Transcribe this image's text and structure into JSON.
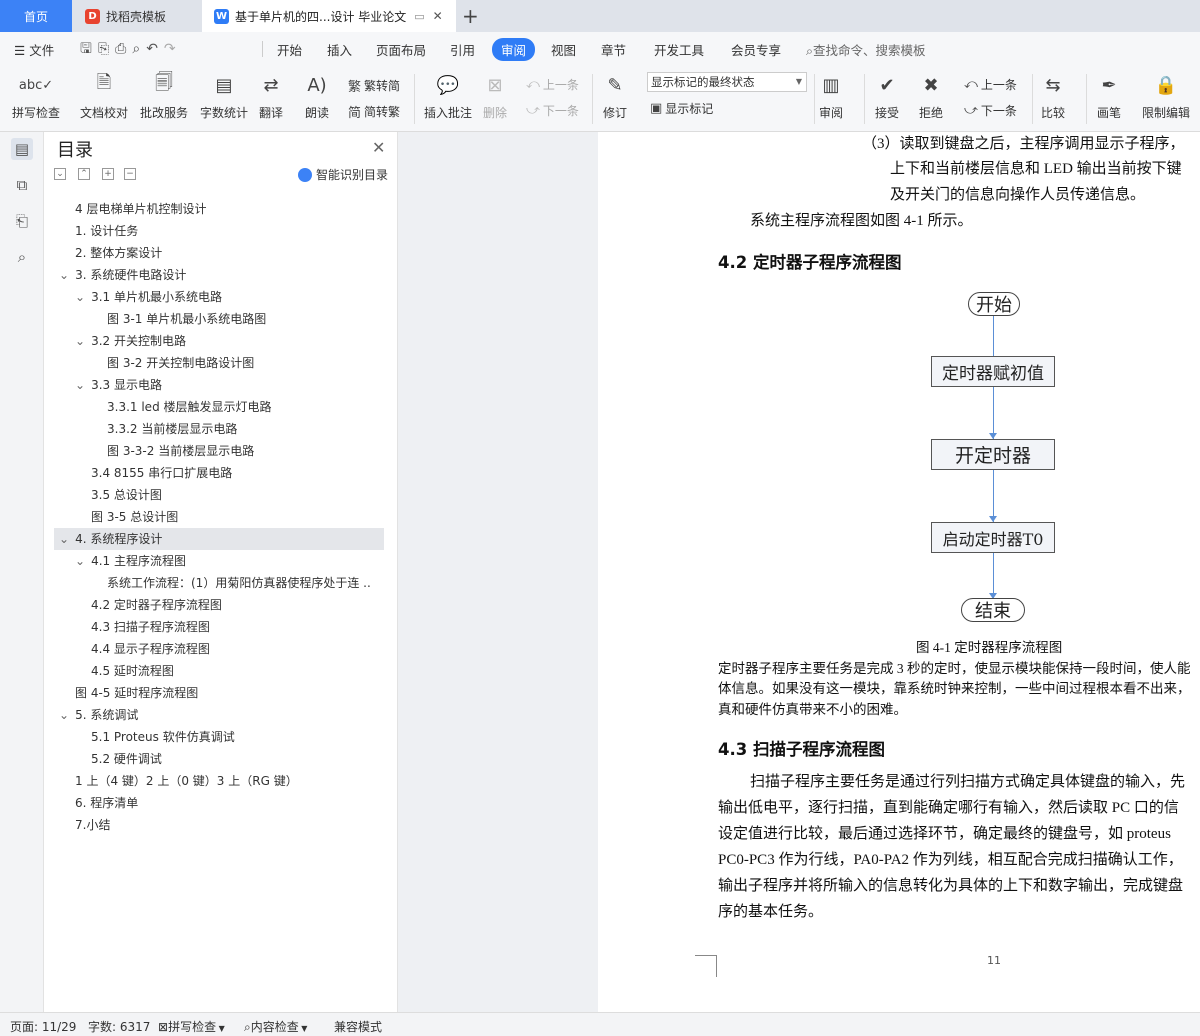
{
  "tabs": {
    "home": "首页",
    "template": "找稻壳模板",
    "document": "基于单片机的四...设计 毕业论文"
  },
  "menu": {
    "file": "文件",
    "items": [
      "开始",
      "插入",
      "页面布局",
      "引用",
      "审阅",
      "视图",
      "章节",
      "开发工具",
      "会员专享"
    ],
    "search": "查找命令、搜索模板"
  },
  "ribbon": {
    "spell": "拼写检查",
    "proof": "文档校对",
    "batch": "批改服务",
    "wordcount": "字数统计",
    "translate": "翻译",
    "read": "朗读",
    "to_trad": "繁转简",
    "to_simp": "简转繁",
    "insert_comment": "插入批注",
    "delete": "删除",
    "prev": "上一条",
    "next": "下一条",
    "track": "修订",
    "markup_state": "显示标记的最终状态",
    "show_markup": "显示标记",
    "review": "审阅",
    "accept": "接受",
    "reject": "拒绝",
    "prev2": "上一条",
    "next2": "下一条",
    "compare": "比较",
    "pen": "画笔",
    "restrict": "限制编辑"
  },
  "nav": {
    "title": "目录",
    "smart": "智能识别目录",
    "items": [
      "4 层电梯单片机控制设计",
      "1. 设计任务",
      "2. 整体方案设计",
      "3. 系统硬件电路设计",
      "3.1  单片机最小系统电路",
      "图 3-1  单片机最小系统电路图",
      "3.2  开关控制电路",
      "图 3-2  开关控制电路设计图",
      "3.3  显示电路",
      "3.3.1 led 楼层触发显示灯电路",
      "3.3.2  当前楼层显示电路",
      "图 3-3-2  当前楼层显示电路",
      "3.4 8155 串行口扩展电路",
      "3.5  总设计图",
      "图 3-5  总设计图",
      "4.  系统程序设计",
      "4.1  主程序流程图",
      "系统工作流程：(1）用菊阳仿真器使程序处于连 ...",
      "4.2  定时器子程序流程图",
      "4.3  扫描子程序流程图",
      "4.4  显示子程序流程图",
      "4.5  延时流程图",
      "图 4-5  延时程序流程图",
      "5.  系统调试",
      "5.1 Proteus 软件仿真调试",
      "5.2  硬件调试",
      "1 上（4 键）2 上（0 键）3 上（RG 键）",
      "6.  程序清单",
      "7.小结"
    ]
  },
  "doc": {
    "line1": "（3）读取到键盘之后，主程序调用显示子程序，",
    "line2": "上下和当前楼层信息和 LED 输出当前按下键",
    "line3": "及开关门的信息向操作人员传递信息。",
    "line4": "系统主程序流程图如图 4-1 所示。",
    "h42": "4.2  定时器子程序流程图",
    "flow": {
      "start": "开始",
      "step1": "定时器赋初值",
      "step2": "开定时器",
      "step3": "启动定时器T0",
      "end": "结束"
    },
    "caption": "图 4-1  定时器程序流程图",
    "p1a": "定时器子程序主要任务是完成 3 秒的定时，使显示模块能保持一段时间，使人能",
    "p1b": "体信息。如果没有这一模块，靠系统时钟来控制，一些中间过程根本看不出来，",
    "p1c": "真和硬件仿真带来不小的困难。",
    "h43": "4.3  扫描子程序流程图",
    "p2a": "扫描子程序主要任务是通过行列扫描方式确定具体键盘的输入，先",
    "p2b": "输出低电平，逐行扫描，直到能确定哪行有输入，然后读取 PC 口的信",
    "p2c": "设定值进行比较，最后通过选择环节，确定最终的键盘号，如 proteus",
    "p2d": "PC0-PC3 作为行线，PA0-PA2 作为列线，相互配合完成扫描确认工作，",
    "p2e": "输出子程序并将所输入的信息转化为具体的上下和数字输出，完成键盘",
    "p2f": "序的基本任务。",
    "page_number": "11"
  },
  "status": {
    "page": "页面: 11/29",
    "words": "字数: 6317",
    "spell": "拼写检查",
    "content": "内容检查",
    "compat": "兼容模式"
  }
}
